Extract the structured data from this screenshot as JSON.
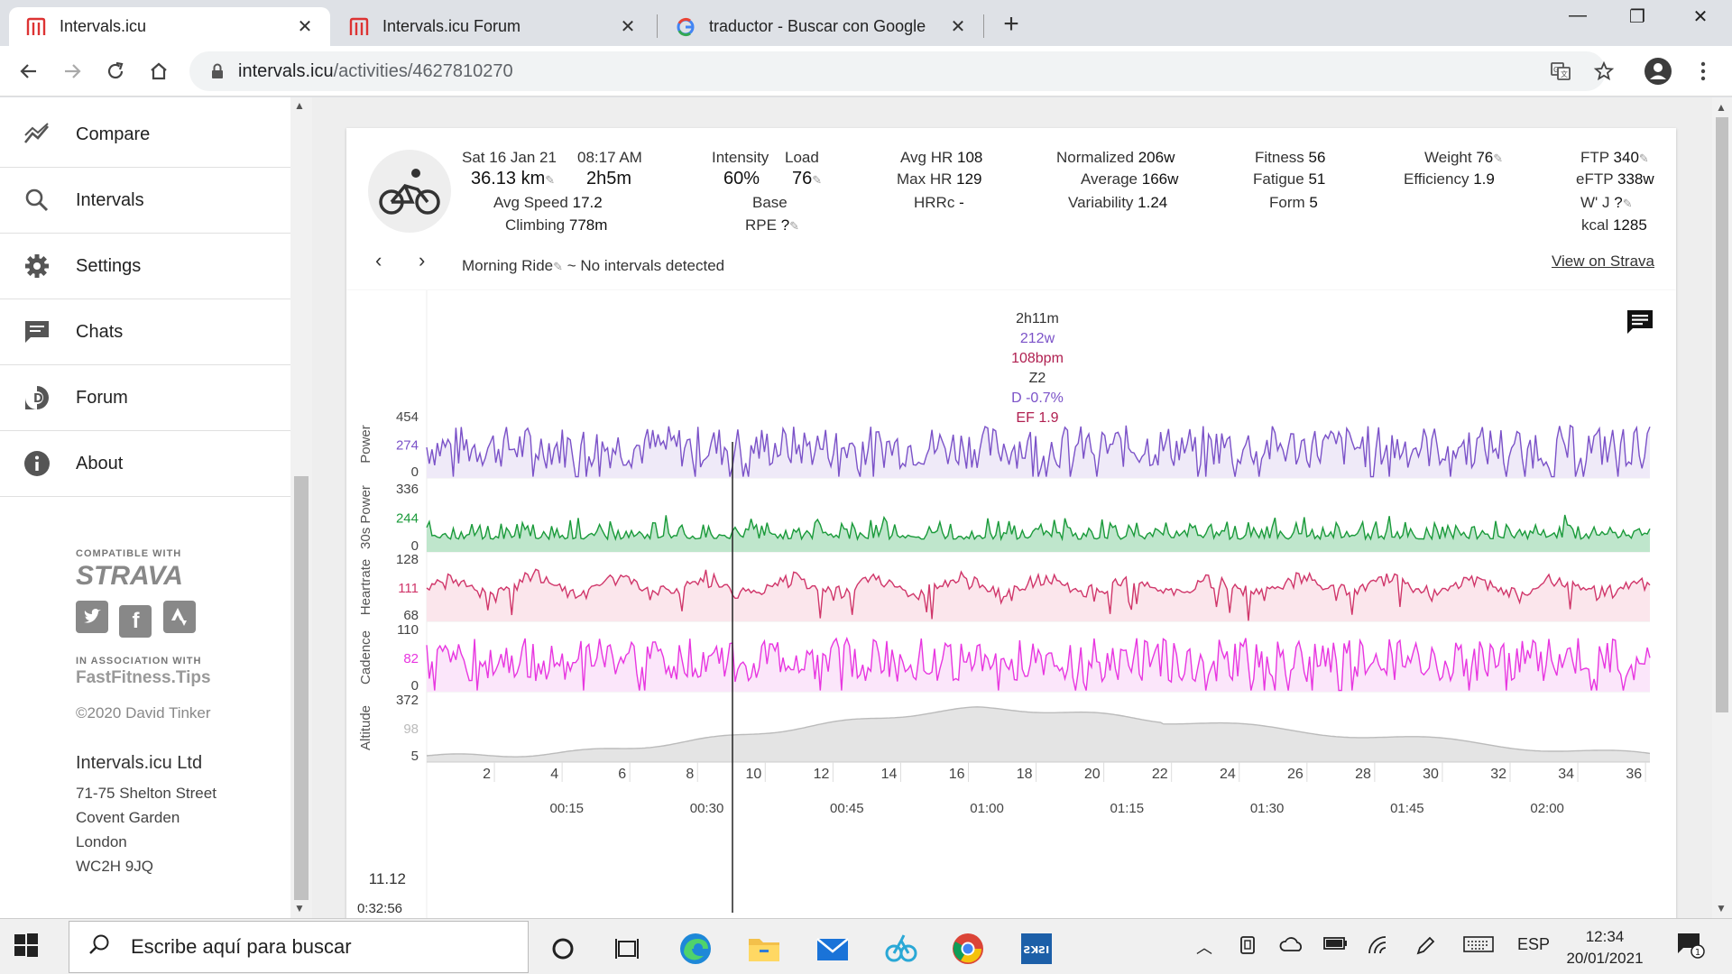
{
  "tabs": [
    {
      "title": "Intervals.icu",
      "active": true
    },
    {
      "title": "Intervals.icu Forum",
      "active": false
    },
    {
      "title": "traductor - Buscar con Google",
      "active": false
    }
  ],
  "address": {
    "host": "intervals.icu",
    "path": "/activities/4627810270"
  },
  "sidebar": {
    "items": [
      {
        "label": "Compare"
      },
      {
        "label": "Intervals"
      },
      {
        "label": "Settings"
      },
      {
        "label": "Chats"
      },
      {
        "label": "Forum"
      },
      {
        "label": "About"
      }
    ],
    "compatible": "COMPATIBLE WITH",
    "strava": "STRAVA",
    "association": "IN ASSOCIATION WITH",
    "fastfitness": "FastFitness.Tips",
    "copyright": "©2020 David Tinker",
    "company": "Intervals.icu Ltd",
    "address_lines": [
      "71-75 Shelton Street",
      "Covent Garden",
      "London",
      "WC2H 9JQ"
    ]
  },
  "activity": {
    "date": "Sat 16 Jan 21",
    "time": "08:17 AM",
    "distance": "36.13 km",
    "duration": "2h5m",
    "avg_speed_label": "Avg Speed",
    "avg_speed": "17.2",
    "climbing_label": "Climbing",
    "climbing": "778m",
    "intensity_label": "Intensity",
    "intensity": "60%",
    "load_label": "Load",
    "load": "76",
    "base": "Base",
    "rpe_label": "RPE",
    "rpe": "?",
    "avg_hr_label": "Avg HR",
    "avg_hr": "108",
    "max_hr_label": "Max HR",
    "max_hr": "129",
    "hrrc_label": "HRRc",
    "hrrc": "-",
    "normalized_label": "Normalized",
    "normalized": "206w",
    "average_label": "Average",
    "average": "166w",
    "variability_label": "Variability",
    "variability": "1.24",
    "fitness_label": "Fitness",
    "fitness": "56",
    "fatigue_label": "Fatigue",
    "fatigue": "51",
    "form_label": "Form",
    "form": "5",
    "weight_label": "Weight",
    "weight": "76",
    "efficiency_label": "Efficiency",
    "efficiency": "1.9",
    "ftp_label": "FTP",
    "ftp": "340",
    "eftp_label": "eFTP",
    "eftp": "338w",
    "wj_label": "W' J",
    "wj": "?",
    "kcal_label": "kcal",
    "kcal": "1285",
    "name": "Morning Ride",
    "intervals_note": "~ No intervals detected",
    "view_on_strava": "View on Strava"
  },
  "summary": {
    "duration": "2h11m",
    "power": "212w",
    "hr": "108bpm",
    "zone": "Z2",
    "decoupling": "D -0.7%",
    "ef": "EF 1.9"
  },
  "chart_data": {
    "type": "line",
    "cursor": {
      "distance": "11.12",
      "time": "0:32:56"
    },
    "x_distance_ticks": [
      "2",
      "4",
      "6",
      "8",
      "10",
      "12",
      "14",
      "16",
      "18",
      "20",
      "22",
      "24",
      "26",
      "28",
      "30",
      "32",
      "34",
      "36"
    ],
    "x_time_ticks": [
      "00:15",
      "00:30",
      "00:45",
      "01:00",
      "01:15",
      "01:30",
      "01:45",
      "02:00"
    ],
    "series": [
      {
        "name": "Power",
        "ticks": [
          "454",
          "274",
          "0"
        ],
        "color": "#7b52c8",
        "fill": "#efeaf8"
      },
      {
        "name": "30s Power",
        "ticks": [
          "336",
          "244",
          "0"
        ],
        "color": "#1a9a3a",
        "fill": "#bfe6cc"
      },
      {
        "name": "Heartrate",
        "ticks": [
          "128",
          "111",
          "68"
        ],
        "color": "#d0366a",
        "fill": "#fbe6ec"
      },
      {
        "name": "Cadence",
        "ticks": [
          "110",
          "82",
          "0"
        ],
        "color": "#e836e0",
        "fill": "#fbe6fa"
      },
      {
        "name": "Altitude",
        "ticks": [
          "372",
          "98",
          "5"
        ],
        "color": "#bbbbbb",
        "fill": "#e4e4e4"
      }
    ]
  },
  "taskbar": {
    "search_placeholder": "Escribe aquí para buscar",
    "language": "ESP",
    "time": "12:34",
    "date": "20/01/2021",
    "notifications": "1"
  }
}
